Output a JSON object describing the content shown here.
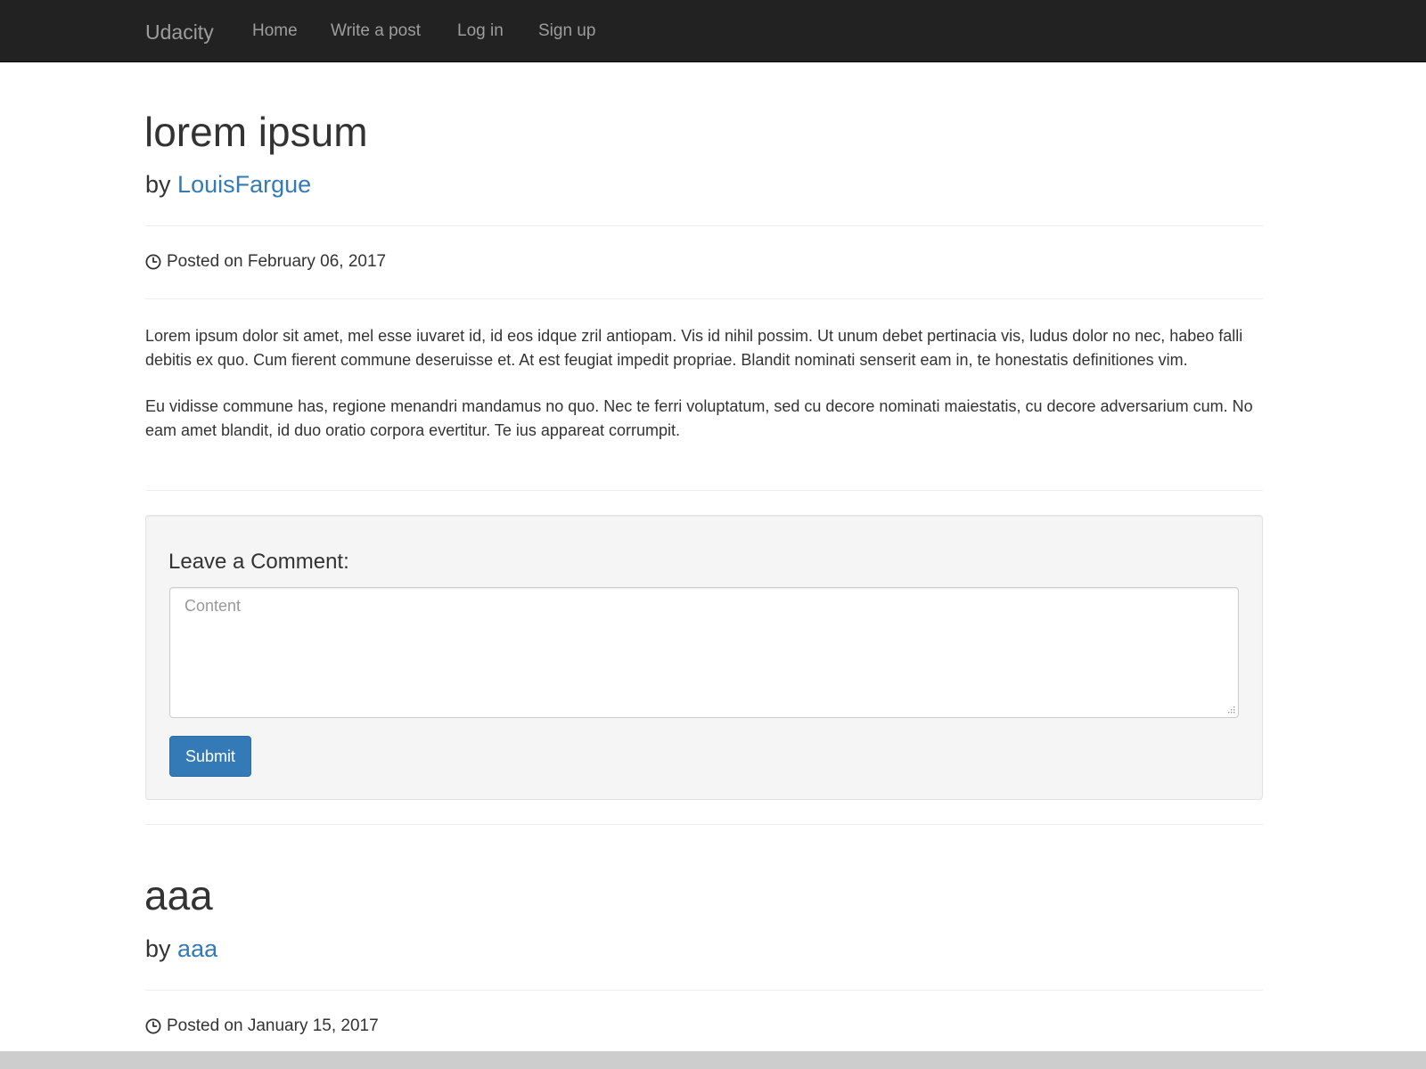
{
  "navbar": {
    "brand": "Udacity",
    "links": [
      {
        "label": "Home"
      },
      {
        "label": "Write a post"
      },
      {
        "label": "Log in"
      },
      {
        "label": "Sign up"
      }
    ]
  },
  "posts": [
    {
      "title": "lorem ipsum",
      "by_prefix": "by",
      "author": "LouisFargue",
      "posted_on": "Posted on February 06, 2017",
      "paragraphs": [
        "Lorem ipsum dolor sit amet, mel esse iuvaret id, id eos idque zril antiopam. Vis id nihil possim. Ut unum debet pertinacia vis, ludus dolor no nec, habeo falli debitis ex quo. Cum fierent commune deseruisse et. At est feugiat impedit propriae. Blandit nominati senserit eam in, te honestatis definitiones vim.",
        "Eu vidisse commune has, regione menandri mandamus no quo. Nec te ferri voluptatum, sed cu decore nominati maiestatis, cu decore adversarium cum. No eam amet blandit, id duo oratio corpora evertitur. Te ius appareat corrumpit."
      ]
    },
    {
      "title": "aaa",
      "by_prefix": "by",
      "author": "aaa",
      "posted_on": "Posted on January 15, 2017"
    }
  ],
  "comment_form": {
    "heading": "Leave a Comment:",
    "placeholder": "Content",
    "value": "",
    "submit_label": "Submit"
  },
  "icons": {
    "clock": "clock-icon",
    "resize_grip": "resize-grip-icon"
  },
  "colors": {
    "navbar_bg": "#222222",
    "nav_text": "#9d9d9d",
    "link": "#337ab7",
    "button_primary": "#337ab7",
    "well_bg": "#f5f5f5"
  }
}
